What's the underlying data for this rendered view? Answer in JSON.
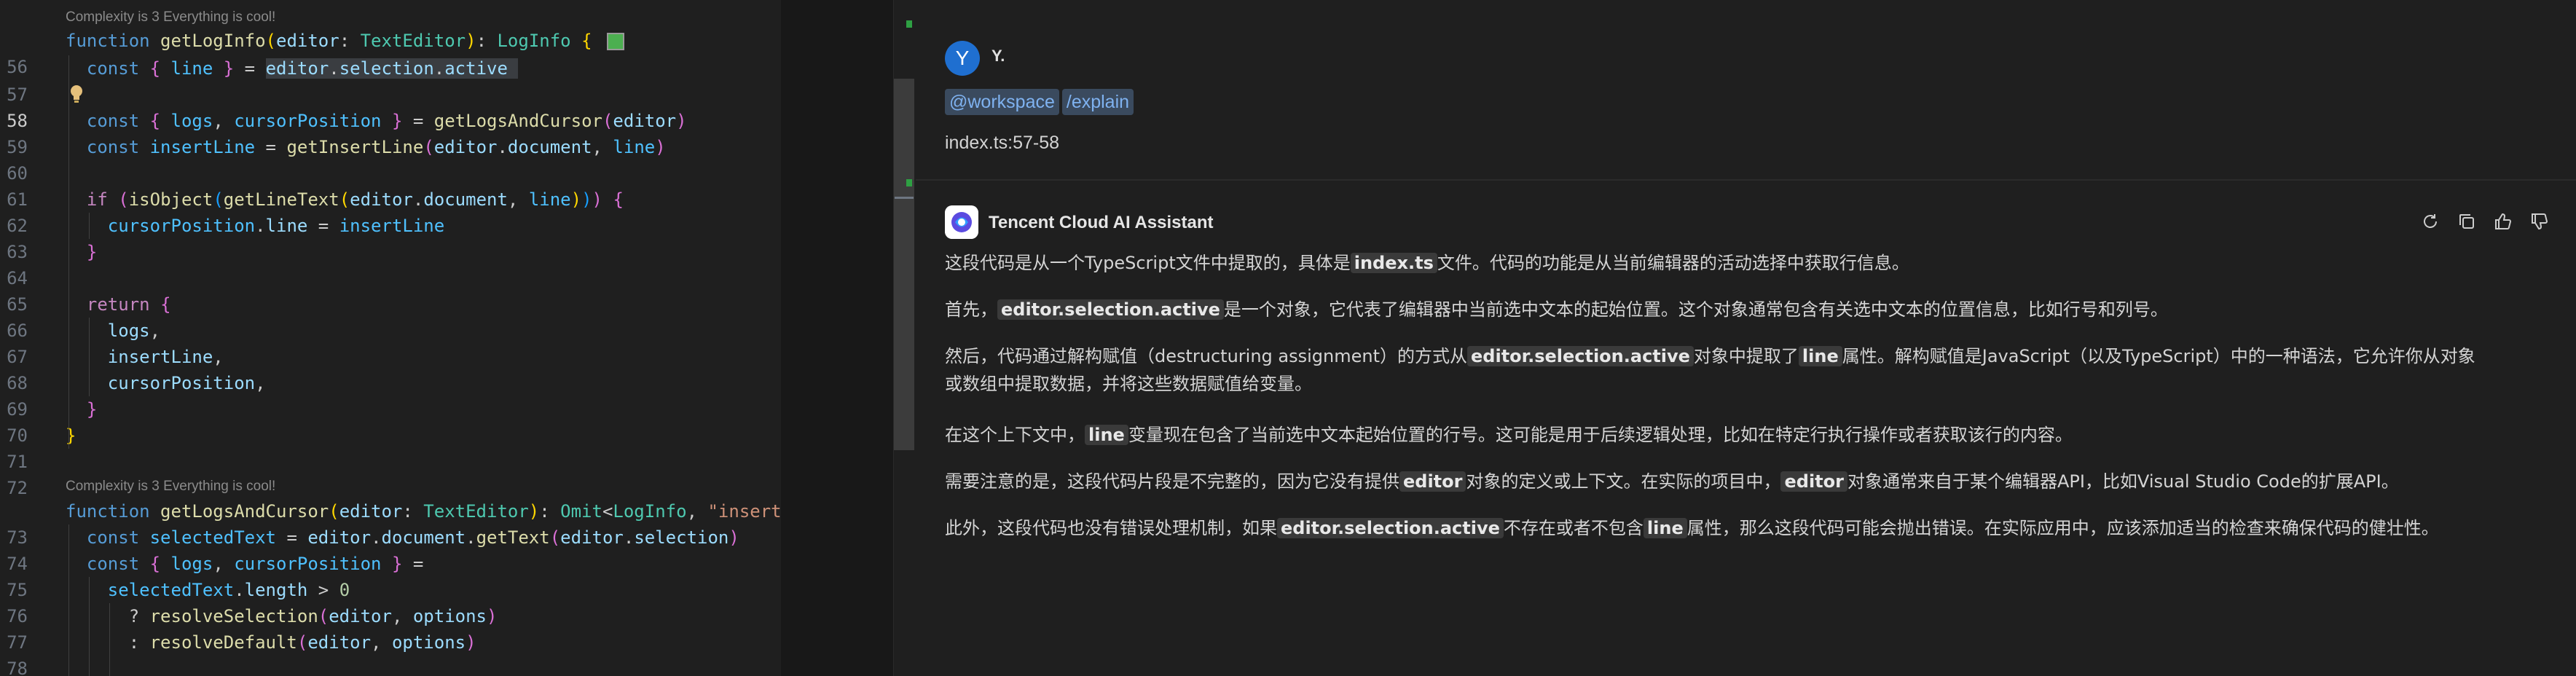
{
  "editor": {
    "codelens_1": "Complexity is 3 Everything is cool!",
    "codelens_2": "Complexity is 3 Everything is cool!",
    "line_numbers": [
      "56",
      "57",
      "58",
      "59",
      "60",
      "61",
      "62",
      "63",
      "64",
      "65",
      "66",
      "67",
      "68",
      "69",
      "70",
      "71",
      "72",
      "73",
      "74",
      "75",
      "76",
      "77",
      "78"
    ],
    "current_line": "58"
  },
  "chat": {
    "user": {
      "avatar_letter": "Y",
      "name": "Y.",
      "chip_workspace": "@workspace",
      "chip_command": "/explain",
      "file_ref": "index.ts:57-58"
    },
    "assistant": {
      "name": "Tencent Cloud AI Assistant",
      "p1": [
        "这段代码是从一个TypeScript文件中提取的，具体是",
        "index.ts",
        "文件。代码的功能是从当前编辑器的活动选择中获取行信息。"
      ],
      "p2": [
        "首先，",
        "editor.selection.active",
        "是一个对象，它代表了编辑器中当前选中文本的起始位置。这个对象通常包含有关选中文本的位置信息，比如行号和列号。"
      ],
      "p3": [
        "然后，代码通过解构赋值（destructuring assignment）的方式从",
        "editor.selection.active",
        "对象中提取了",
        "line",
        "属性。解构赋值是JavaScript（以及TypeScript）中的一种语法，它允许你从对象",
        "或数组中提取数据，并将这些数据赋值给变量。"
      ],
      "p4": [
        "在这个上下文中，",
        "line",
        "变量现在包含了当前选中文本起始位置的行号。这可能是用于后续逻辑处理，比如在特定行执行操作或者获取该行的内容。"
      ],
      "p5": [
        "需要注意的是，这段代码片段是不完整的，因为它没有提供",
        "editor",
        "对象的定义或上下文。在实际的项目中，",
        "editor",
        "对象通常来自于某个编辑器API，比如Visual Studio Code的扩展API。"
      ],
      "p6": [
        "此外，这段代码也没有错误处理机制，如果",
        "editor.selection.active",
        "不存在或者不包含",
        "line",
        "属性，那么这段代码可能会抛出错误。在实际应用中，应该添加适当的检查来确保代码的健壮性。"
      ]
    }
  }
}
